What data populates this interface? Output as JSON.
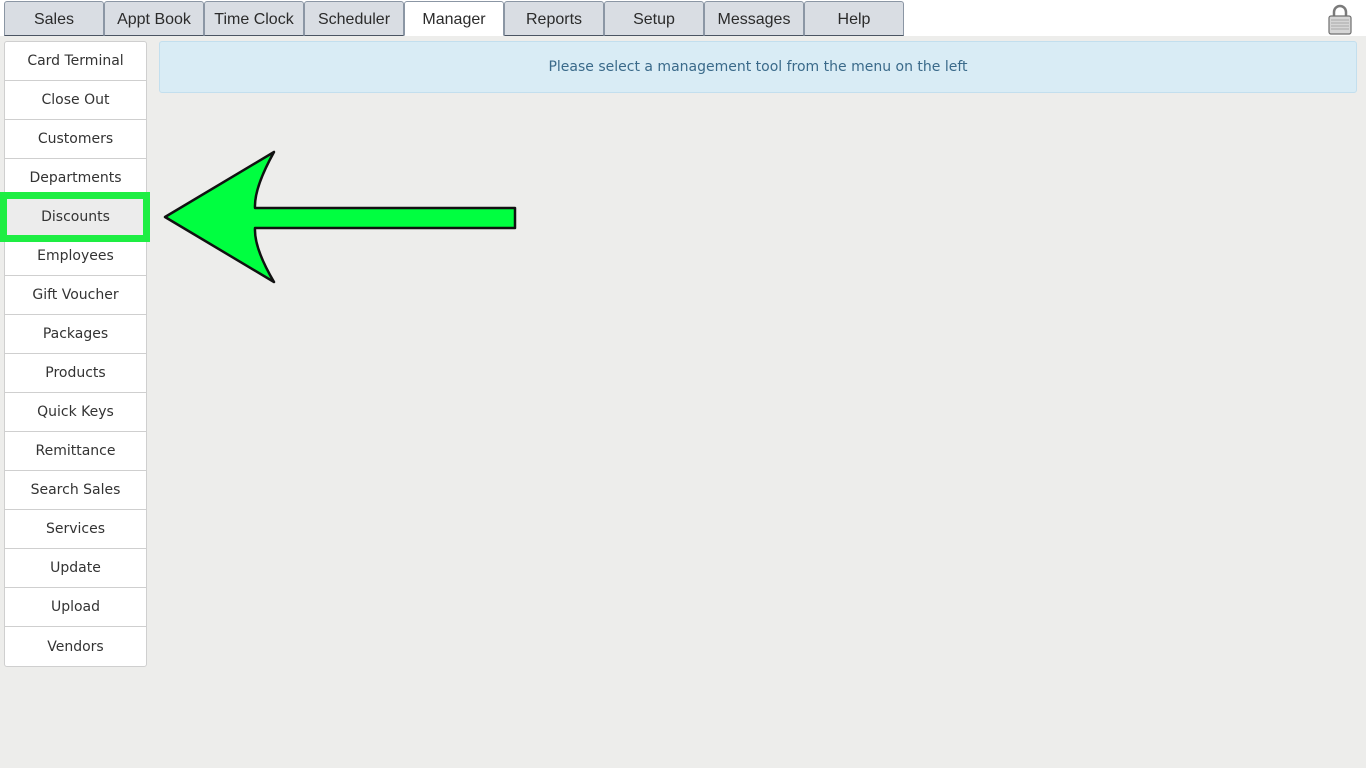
{
  "tabs": [
    {
      "label": "Sales"
    },
    {
      "label": "Appt Book"
    },
    {
      "label": "Time Clock"
    },
    {
      "label": "Scheduler"
    },
    {
      "label": "Manager",
      "active": true
    },
    {
      "label": "Reports"
    },
    {
      "label": "Setup"
    },
    {
      "label": "Messages"
    },
    {
      "label": "Help"
    }
  ],
  "lock_icon": "lock-icon",
  "sidebar": {
    "items": [
      {
        "label": "Card Terminal"
      },
      {
        "label": "Close Out"
      },
      {
        "label": "Customers"
      },
      {
        "label": "Departments"
      },
      {
        "label": "Discounts",
        "selected": true
      },
      {
        "label": "Employees"
      },
      {
        "label": "Gift Voucher"
      },
      {
        "label": "Packages"
      },
      {
        "label": "Products"
      },
      {
        "label": "Quick Keys"
      },
      {
        "label": "Remittance"
      },
      {
        "label": "Search Sales"
      },
      {
        "label": "Services"
      },
      {
        "label": "Update"
      },
      {
        "label": "Upload"
      },
      {
        "label": "Vendors"
      }
    ]
  },
  "main": {
    "info_message": "Please select a management tool from the menu on the left"
  },
  "annotation": {
    "arrow_icon": "left-arrow-icon",
    "arrow_color": "#00ff40",
    "highlight_color": "#1eee43"
  }
}
